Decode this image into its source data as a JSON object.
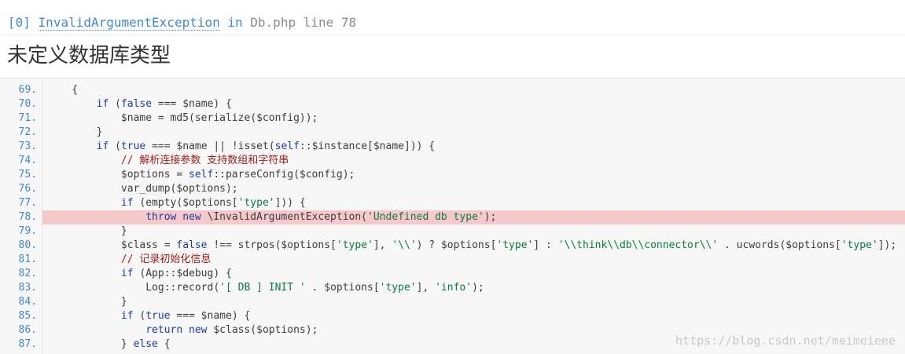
{
  "exception": {
    "index": "[0]",
    "class_name": "InvalidArgumentException",
    "in_word": "in",
    "location": "Db.php line 78"
  },
  "message": "未定义数据库类型",
  "source": {
    "highlight_line": "78",
    "lines": [
      {
        "num": "69.",
        "code": [
          {
            "t": "    {",
            "k": ""
          }
        ]
      },
      {
        "num": "70.",
        "code": [
          {
            "t": "        ",
            "k": ""
          },
          {
            "t": "if",
            "k": "k"
          },
          {
            "t": " (",
            "k": ""
          },
          {
            "t": "false",
            "k": "k"
          },
          {
            "t": " === $name) {",
            "k": ""
          }
        ]
      },
      {
        "num": "71.",
        "code": [
          {
            "t": "            $name = md5(serialize($config));",
            "k": ""
          }
        ]
      },
      {
        "num": "72.",
        "code": [
          {
            "t": "        }",
            "k": ""
          }
        ]
      },
      {
        "num": "73.",
        "code": [
          {
            "t": "        ",
            "k": ""
          },
          {
            "t": "if",
            "k": "k"
          },
          {
            "t": " (",
            "k": ""
          },
          {
            "t": "true",
            "k": "k"
          },
          {
            "t": " === $name || !isset(",
            "k": ""
          },
          {
            "t": "self",
            "k": "k"
          },
          {
            "t": "::$instance[$name])) {",
            "k": ""
          }
        ]
      },
      {
        "num": "74.",
        "code": [
          {
            "t": "            // 解析连接参数 支持数组和字符串",
            "k": "c"
          }
        ]
      },
      {
        "num": "75.",
        "code": [
          {
            "t": "            $options = ",
            "k": ""
          },
          {
            "t": "self",
            "k": "k"
          },
          {
            "t": "::parseConfig($config);",
            "k": ""
          }
        ]
      },
      {
        "num": "76.",
        "code": [
          {
            "t": "            var_dump($options);",
            "k": ""
          }
        ]
      },
      {
        "num": "77.",
        "code": [
          {
            "t": "            ",
            "k": ""
          },
          {
            "t": "if",
            "k": "k"
          },
          {
            "t": " (empty($options[",
            "k": ""
          },
          {
            "t": "'type'",
            "k": "s"
          },
          {
            "t": "])) {",
            "k": ""
          }
        ]
      },
      {
        "num": "78.",
        "code": [
          {
            "t": "                ",
            "k": ""
          },
          {
            "t": "throw",
            "k": "k"
          },
          {
            "t": " ",
            "k": ""
          },
          {
            "t": "new",
            "k": "k"
          },
          {
            "t": " \\InvalidArgumentException(",
            "k": ""
          },
          {
            "t": "'Undefined db type'",
            "k": "s"
          },
          {
            "t": ");",
            "k": ""
          }
        ]
      },
      {
        "num": "79.",
        "code": [
          {
            "t": "            }",
            "k": ""
          }
        ]
      },
      {
        "num": "80.",
        "code": [
          {
            "t": "            $class = ",
            "k": ""
          },
          {
            "t": "false",
            "k": "k"
          },
          {
            "t": " !== strpos($options[",
            "k": ""
          },
          {
            "t": "'type'",
            "k": "s"
          },
          {
            "t": "], ",
            "k": ""
          },
          {
            "t": "'\\\\'",
            "k": "s"
          },
          {
            "t": ") ? $options[",
            "k": ""
          },
          {
            "t": "'type'",
            "k": "s"
          },
          {
            "t": "] : ",
            "k": ""
          },
          {
            "t": "'\\\\think\\\\db\\\\connector\\\\'",
            "k": "s"
          },
          {
            "t": " . ucwords($options[",
            "k": ""
          },
          {
            "t": "'type'",
            "k": "s"
          },
          {
            "t": "]);",
            "k": ""
          }
        ]
      },
      {
        "num": "81.",
        "code": [
          {
            "t": "            // 记录初始化信息",
            "k": "c"
          }
        ]
      },
      {
        "num": "82.",
        "code": [
          {
            "t": "            ",
            "k": ""
          },
          {
            "t": "if",
            "k": "k"
          },
          {
            "t": " (App::$debug) {",
            "k": ""
          }
        ]
      },
      {
        "num": "83.",
        "code": [
          {
            "t": "                Log::record(",
            "k": ""
          },
          {
            "t": "'[ DB ] INIT '",
            "k": "s"
          },
          {
            "t": " . $options[",
            "k": ""
          },
          {
            "t": "'type'",
            "k": "s"
          },
          {
            "t": "], ",
            "k": ""
          },
          {
            "t": "'info'",
            "k": "s"
          },
          {
            "t": ");",
            "k": ""
          }
        ]
      },
      {
        "num": "84.",
        "code": [
          {
            "t": "            }",
            "k": ""
          }
        ]
      },
      {
        "num": "85.",
        "code": [
          {
            "t": "            ",
            "k": ""
          },
          {
            "t": "if",
            "k": "k"
          },
          {
            "t": " (",
            "k": ""
          },
          {
            "t": "true",
            "k": "k"
          },
          {
            "t": " === $name) {",
            "k": ""
          }
        ]
      },
      {
        "num": "86.",
        "code": [
          {
            "t": "                ",
            "k": ""
          },
          {
            "t": "return",
            "k": "k"
          },
          {
            "t": " ",
            "k": ""
          },
          {
            "t": "new",
            "k": "k"
          },
          {
            "t": " $class($options);",
            "k": ""
          }
        ]
      },
      {
        "num": "87.",
        "code": [
          {
            "t": "            } ",
            "k": ""
          },
          {
            "t": "else",
            "k": "k"
          },
          {
            "t": " {",
            "k": ""
          }
        ]
      }
    ]
  },
  "watermark": "https://blog.csdn.net/meimeieee",
  "colors": {
    "accent": "#4288ce",
    "highlight": "#f5c9cb",
    "keyword": "#1f3c9e",
    "string": "#0b7a44",
    "comment": "#9b1a1a"
  }
}
